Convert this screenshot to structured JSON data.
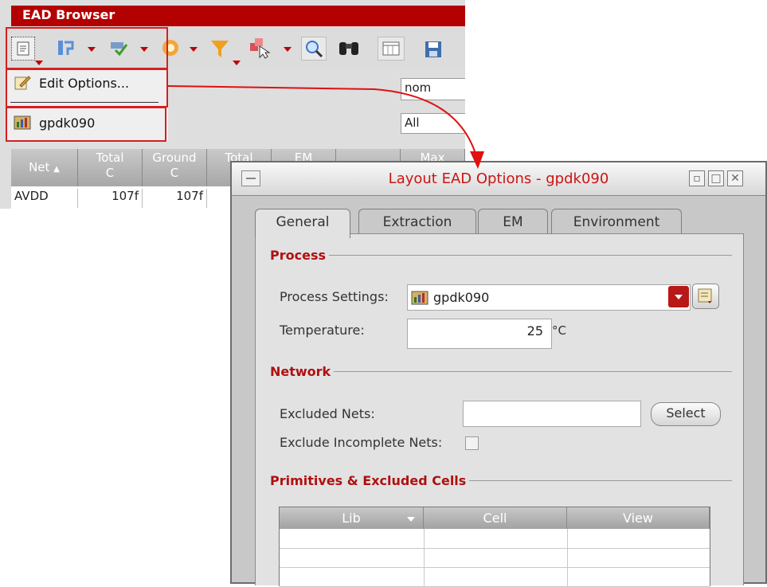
{
  "browser": {
    "title": "EAD Browser",
    "menu": {
      "edit_options": "Edit Options...",
      "process_item": "gpdk090"
    },
    "combos": {
      "corner": "nom",
      "filter": "All"
    },
    "grid": {
      "columns": [
        {
          "line1": "Net",
          "line2": ""
        },
        {
          "line1": "Total",
          "line2": "C"
        },
        {
          "line1": "Ground",
          "line2": "C"
        },
        {
          "line1": "Total",
          "line2": ""
        },
        {
          "line1": "EM",
          "line2": ""
        },
        {
          "line1": "",
          "line2": ""
        },
        {
          "line1": "Max",
          "line2": ""
        }
      ],
      "rows": [
        {
          "net": "AVDD",
          "total_c": "107f",
          "ground_c": "107f"
        }
      ]
    }
  },
  "dialog": {
    "title": "Layout EAD Options - gpdk090",
    "tabs": [
      "General",
      "Extraction",
      "EM",
      "Environment"
    ],
    "process": {
      "heading": "Process",
      "settings_label": "Process Settings:",
      "settings_value": "gpdk090",
      "temperature_label": "Temperature:",
      "temperature_value": "25",
      "temperature_unit": "°C"
    },
    "network": {
      "heading": "Network",
      "excluded_nets_label": "Excluded Nets:",
      "excluded_nets_value": "",
      "select_label": "Select",
      "exclude_incomplete_label": "Exclude Incomplete Nets:"
    },
    "primitives": {
      "heading": "Primitives & Excluded Cells",
      "columns": [
        "Lib",
        "Cell",
        "View"
      ]
    }
  },
  "colors": {
    "accent_red": "#cc1414",
    "titlebar_red": "#b30000"
  }
}
